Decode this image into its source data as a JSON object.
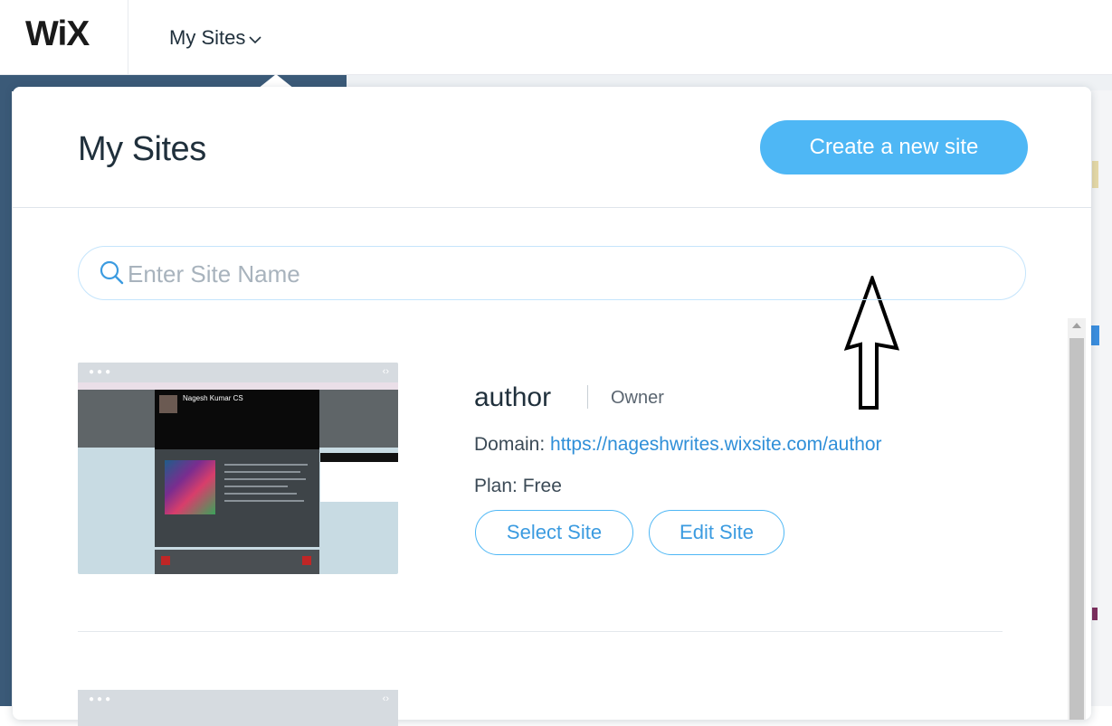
{
  "topbar": {
    "logo": "WiX",
    "menu_label": "My Sites"
  },
  "panel": {
    "title": "My Sites",
    "create_button": "Create a new site",
    "search": {
      "placeholder": "Enter Site Name",
      "value": ""
    }
  },
  "sites": [
    {
      "name": "author",
      "role": "Owner",
      "domain_label": "Domain:",
      "domain_url": "https://nageshwrites.wixsite.com/author",
      "plan_label": "Plan:",
      "plan_value": "Free",
      "select_button": "Select Site",
      "edit_button": "Edit Site",
      "thumbnail_header": "Nagesh Kumar CS"
    }
  ],
  "colors": {
    "accent": "#4eb7f5",
    "link": "#2f8fd8",
    "text": "#20303c",
    "annotation_arrow": "#000000"
  },
  "icons": {
    "menu_chevron": "chevron-down-icon",
    "search": "search-icon",
    "annotation": "up-arrow-icon"
  }
}
